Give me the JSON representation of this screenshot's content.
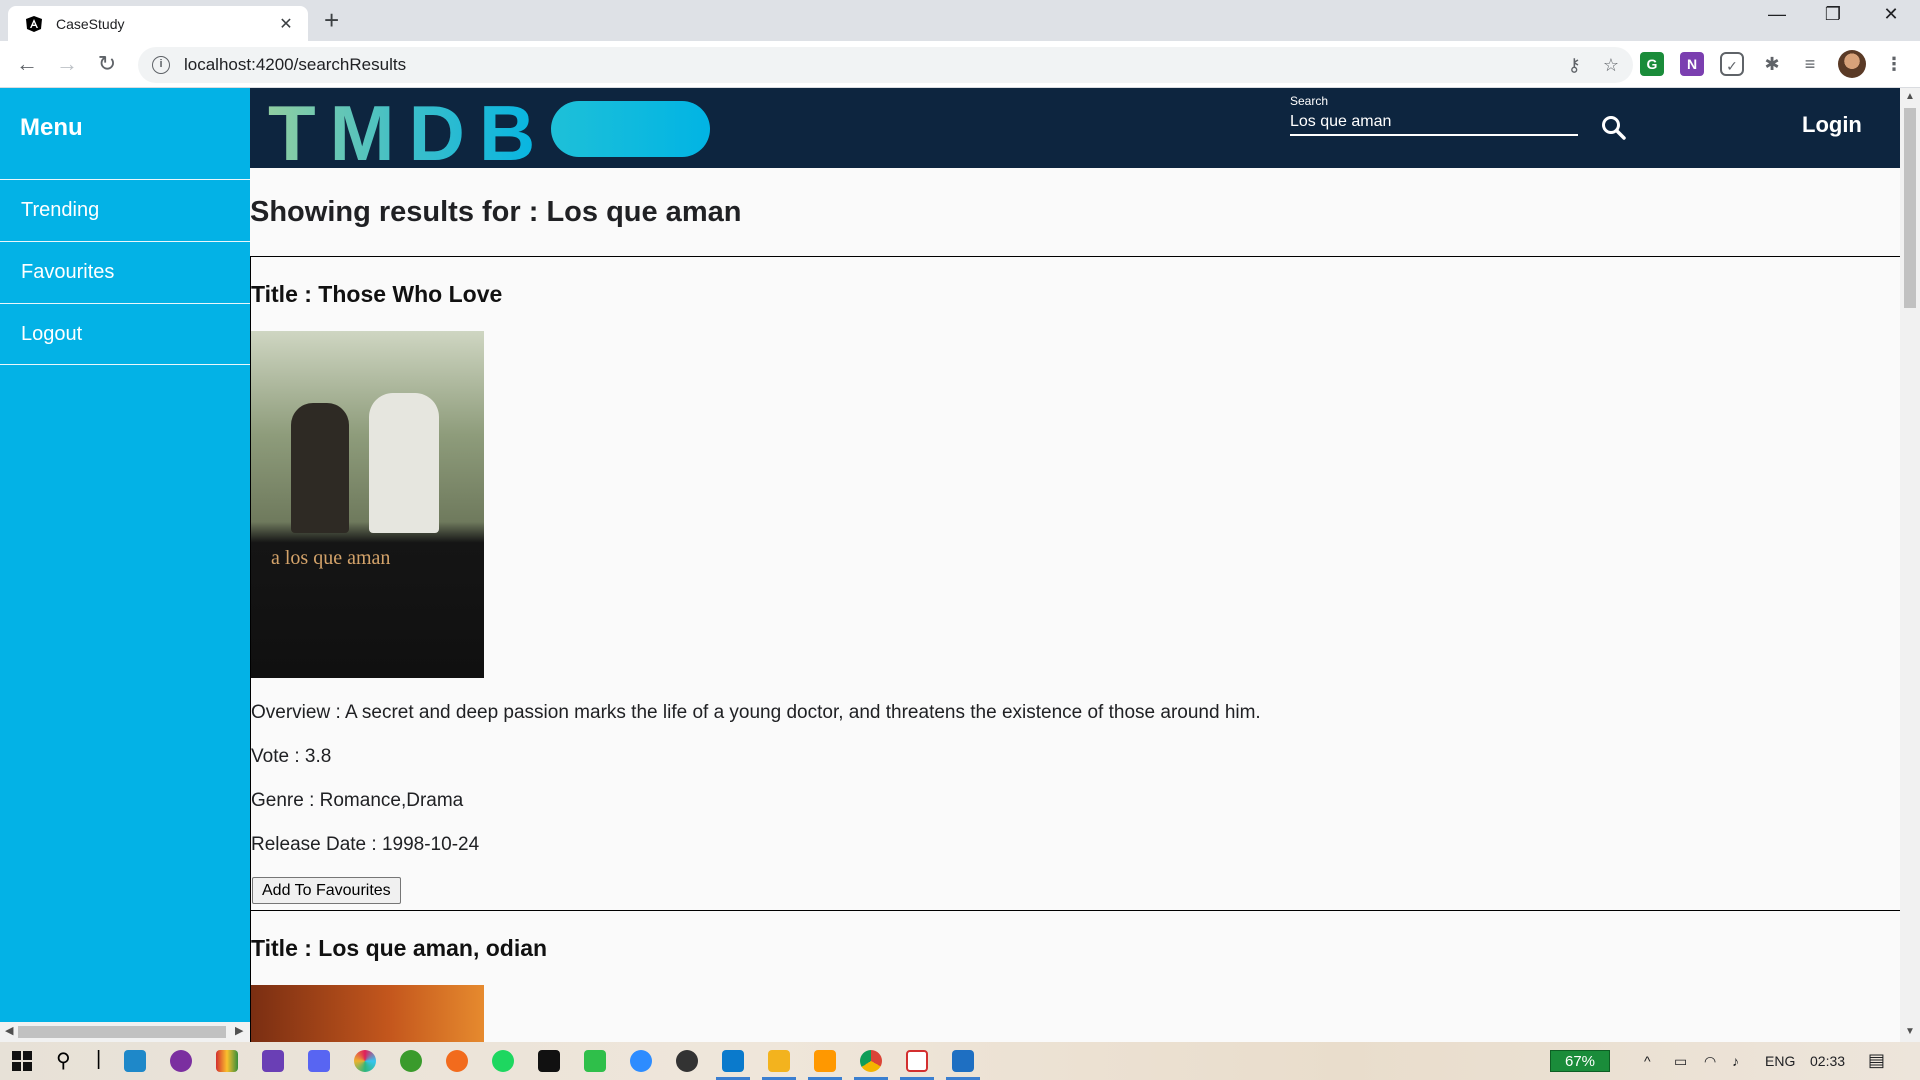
{
  "browser": {
    "tab_title": "CaseStudy",
    "url": "localhost:4200/searchResults",
    "new_tab": "+",
    "tab_close": "✕",
    "minimize": "—",
    "restore": "❐",
    "close": "✕"
  },
  "sidebar": {
    "title": "Menu",
    "items": [
      {
        "label": "Trending"
      },
      {
        "label": "Favourites"
      },
      {
        "label": "Logout"
      }
    ]
  },
  "header": {
    "logo": "TMDB",
    "search_label": "Search",
    "search_value": "Los que aman",
    "login": "Login"
  },
  "main": {
    "heading": "Showing results for : Los que aman",
    "results": [
      {
        "title": "Title : Those Who Love",
        "poster_text": "a los que aman",
        "overview": "Overview : A secret and deep passion marks the life of a young doctor, and threatens the existence of those around him.",
        "vote": "Vote : 3.8",
        "genre": "Genre : Romance,Drama",
        "release": "Release Date : 1998-10-24",
        "button": "Add To Favourites"
      },
      {
        "title": "Title : Los que aman, odian"
      }
    ]
  },
  "taskbar": {
    "battery": "67%",
    "lang": "ENG",
    "time": "02:33"
  }
}
